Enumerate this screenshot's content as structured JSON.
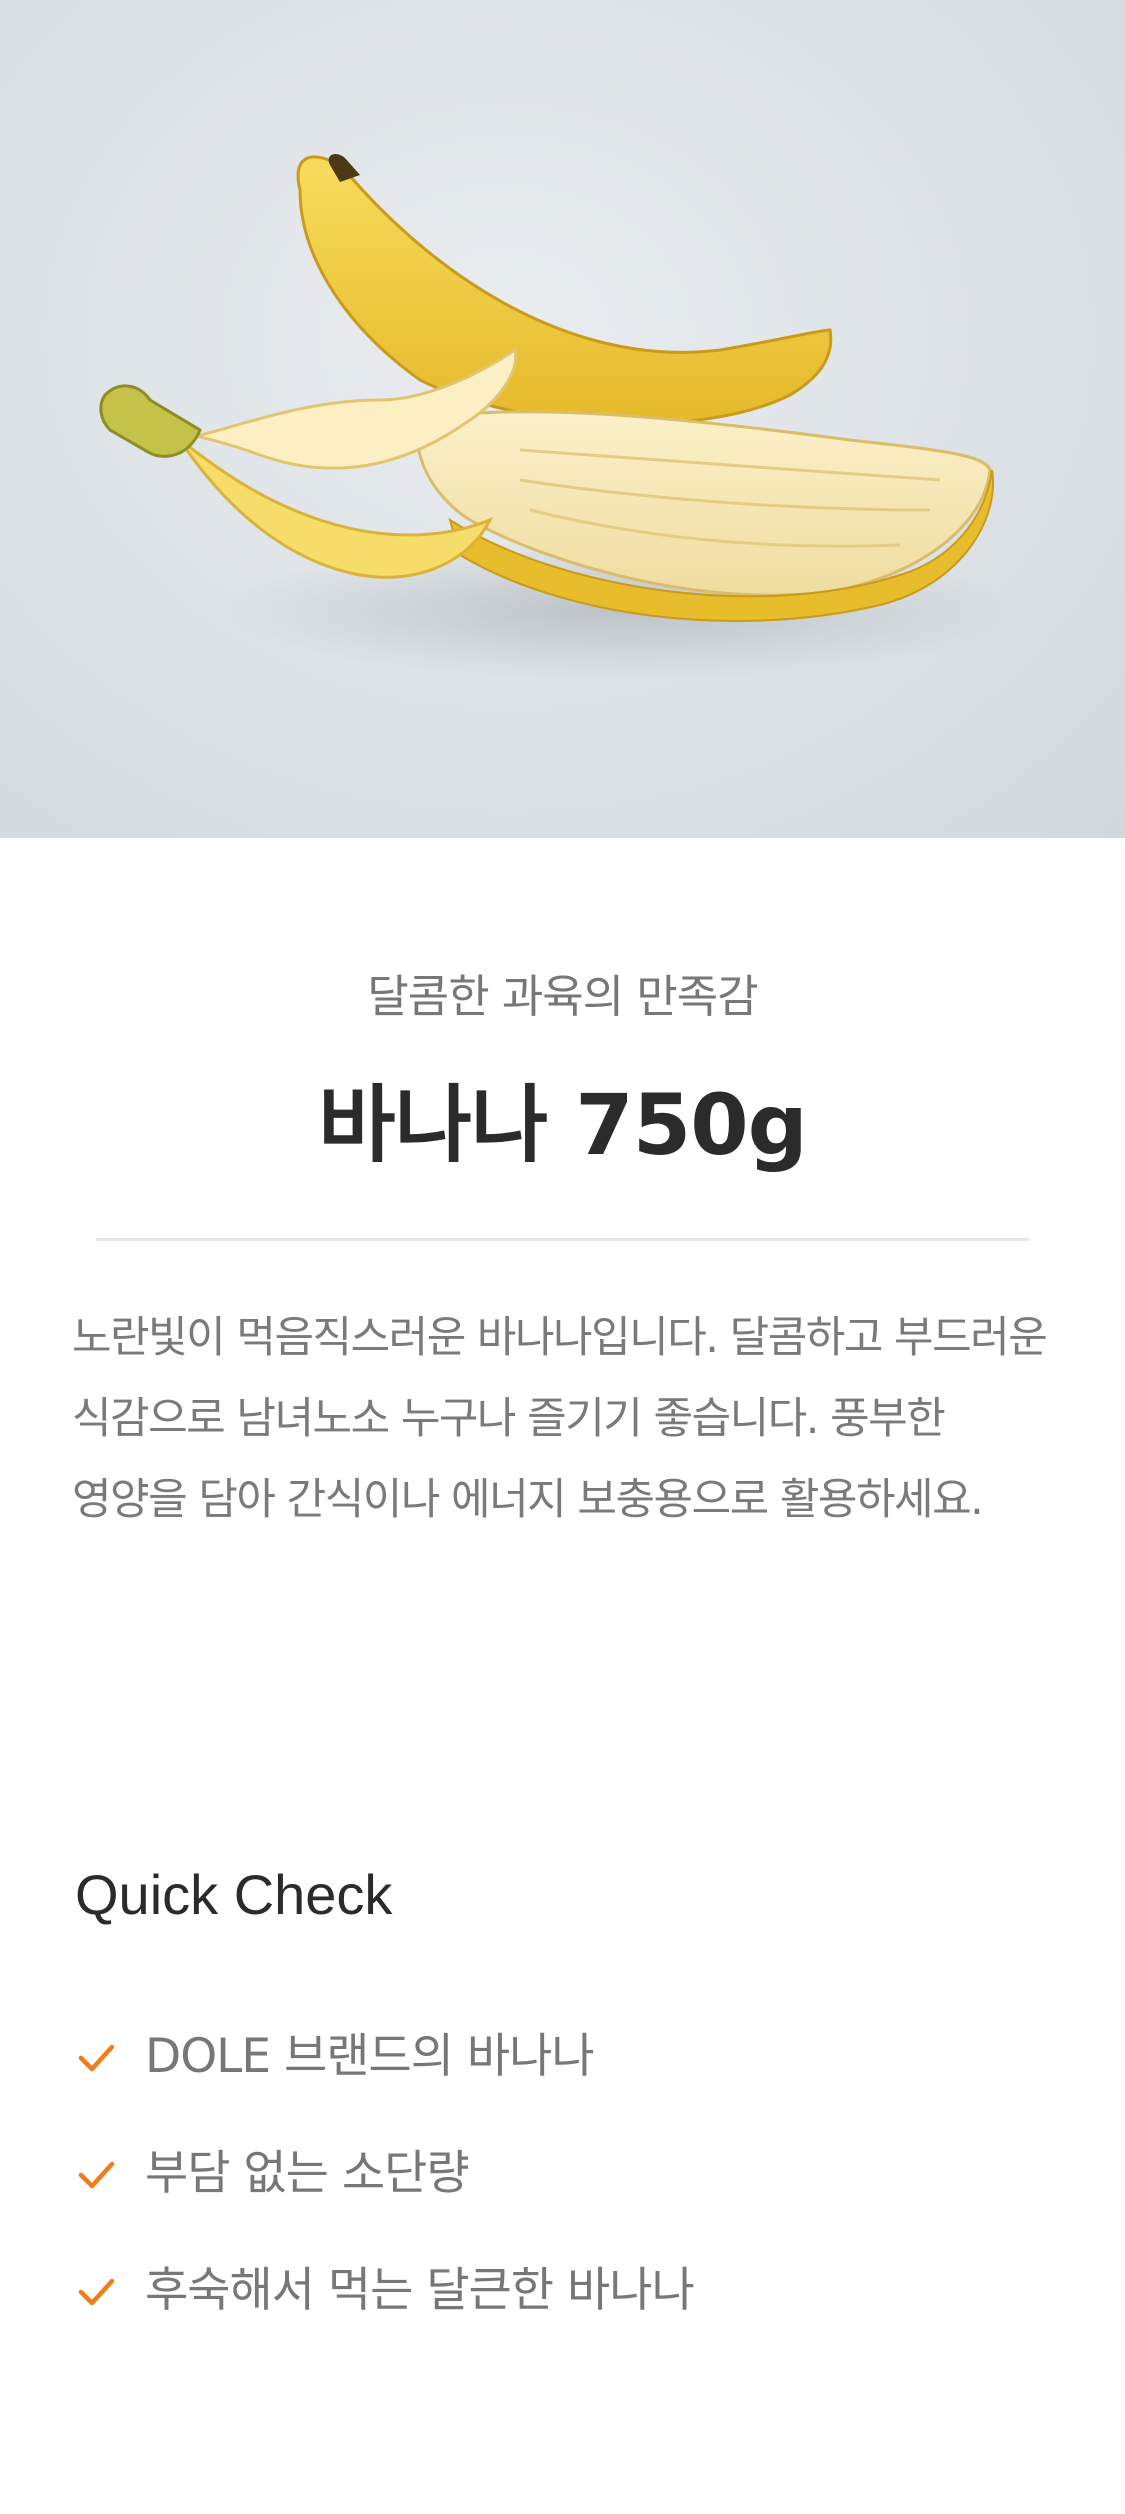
{
  "product": {
    "image_alt": "peeled banana photo",
    "tagline": "달콤한 과육의 만족감",
    "name": "바나나 750g",
    "description": "노란빛이 먹음직스러운 바나나입니다. 달콤하고 부드러운 식감으로 남녀노소 누구나 즐기기 좋습니다. 풍부한 영양을 담아 간식이나 에너지 보충용으로 활용하세요."
  },
  "quick_check": {
    "heading": "Quick Check",
    "items": [
      {
        "icon": "check-icon",
        "label": "DOLE 브랜드의 바나나"
      },
      {
        "icon": "check-icon",
        "label": "부담 없는 소단량"
      },
      {
        "icon": "check-icon",
        "label": "후숙해서 먹는 달큰한 바나나"
      }
    ]
  },
  "colors": {
    "accent": "#ee7d1a",
    "title": "#2b2b2b",
    "body_text": "#777777",
    "divider": "#e6e6e6"
  }
}
